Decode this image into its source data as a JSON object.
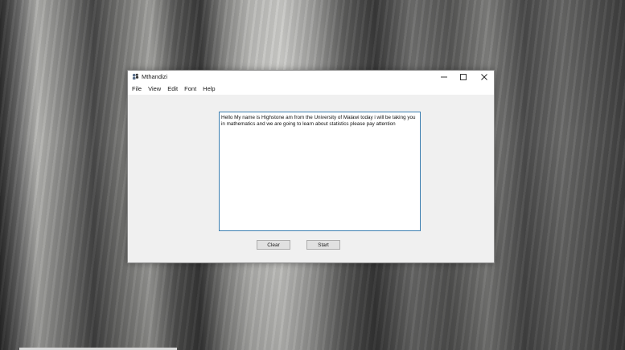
{
  "window": {
    "title": "Mthandizi",
    "controls": {
      "minimize_icon": "minimize-icon",
      "maximize_icon": "maximize-icon",
      "close_icon": "close-icon"
    }
  },
  "menu": {
    "items": [
      {
        "label": "File"
      },
      {
        "label": "View"
      },
      {
        "label": "Edit"
      },
      {
        "label": "Font"
      },
      {
        "label": "Help"
      }
    ]
  },
  "editor": {
    "text": "Hello My name is Highstone am from the University of Malawi today i will be taking you in mathematics and we are going to learn about statistics please pay attention"
  },
  "buttons": {
    "clear_label": "Clear",
    "start_label": "Start"
  },
  "colors": {
    "window_bg": "#f0f0f0",
    "titlebar_bg": "#ffffff",
    "textarea_border": "#3c7fb1",
    "button_bg": "#e1e1e1"
  }
}
